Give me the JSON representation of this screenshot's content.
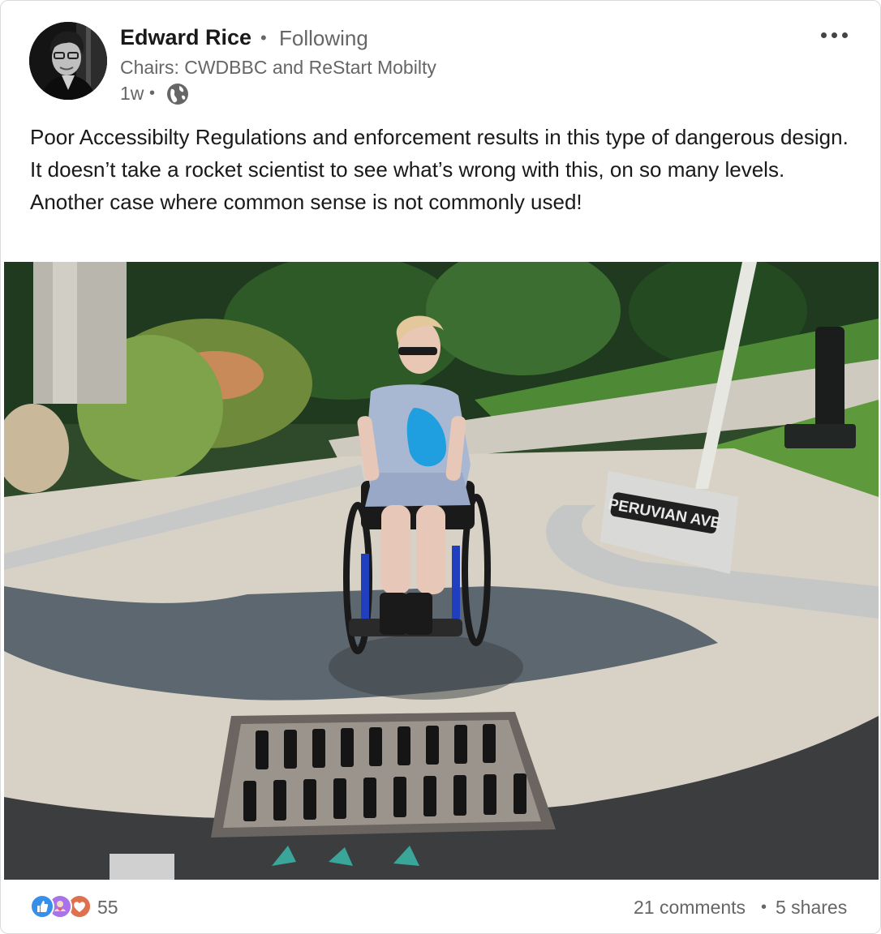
{
  "post": {
    "author": {
      "name": "Edward Rice",
      "follow_status": "Following",
      "headline": "Chairs: CWDBBC and ReStart Mobilty",
      "time_ago": "1w",
      "separator": "•",
      "visibility_icon": "globe-icon",
      "avatar_icon": "profile-photo"
    },
    "menu_icon": "more-horizontal-icon",
    "text": "Poor Accessibilty Regulations and enforcement results in this type of dangerous design. It doesn’t take a rocket scientist to see what’s wrong with this, on so many levels. Another case where common sense is not commonly used!",
    "image": {
      "sign_text": "PERUVIAN AVE"
    },
    "social": {
      "reaction_icons": [
        "like-icon",
        "support-icon",
        "love-icon"
      ],
      "reaction_count": "55",
      "comments": "21 comments",
      "separator": "•",
      "shares": "5 shares"
    },
    "colors": {
      "like": "#378fe9",
      "support": "#a872e8",
      "love": "#df704d",
      "secondary_text": "#666666",
      "primary_text": "#191919"
    }
  }
}
